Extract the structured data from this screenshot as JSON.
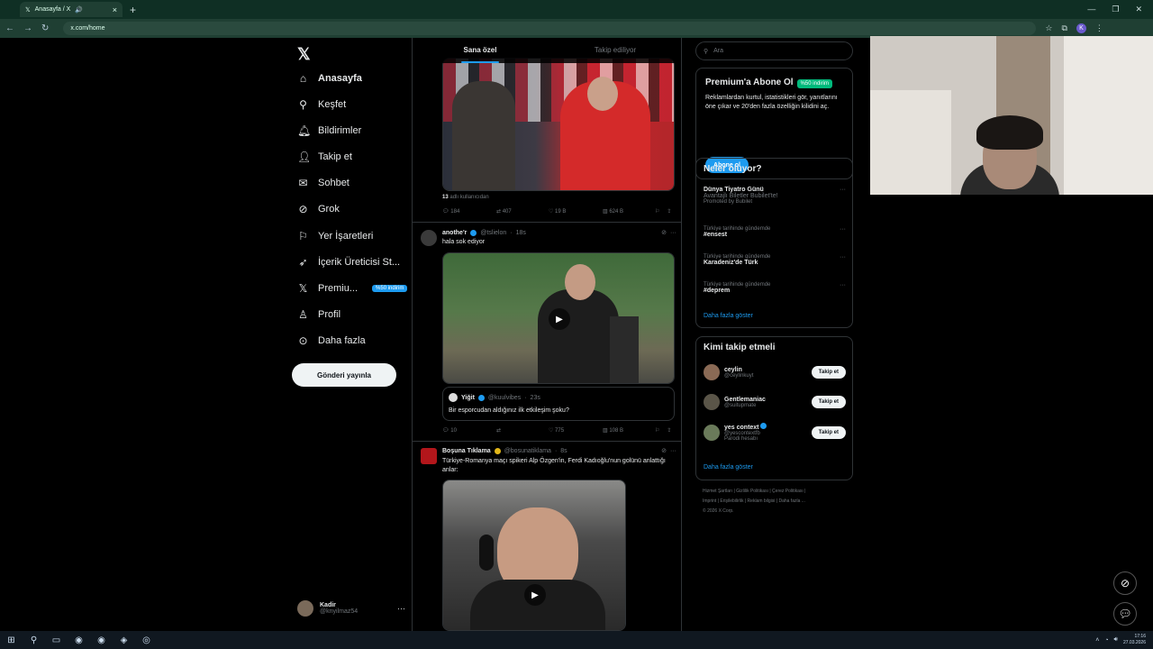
{
  "browser": {
    "tab_title": "Anasayfa / X",
    "url": "x.com/home",
    "profile_letter": "K"
  },
  "nav": {
    "items": [
      {
        "label": "Anasayfa",
        "icon": "home-icon"
      },
      {
        "label": "Keşfet",
        "icon": "search-icon"
      },
      {
        "label": "Bildirimler",
        "icon": "bell-icon"
      },
      {
        "label": "Takip et",
        "icon": "add-user-icon"
      },
      {
        "label": "Sohbet",
        "icon": "mail-icon"
      },
      {
        "label": "Grok",
        "icon": "grok-icon"
      },
      {
        "label": "Yer İşaretleri",
        "icon": "bookmark-icon"
      },
      {
        "label": "İçerik Üreticisi St...",
        "icon": "rocket-icon"
      },
      {
        "label": "Premiu...",
        "icon": "x-icon",
        "badge": "%50 indirim"
      },
      {
        "label": "Profil",
        "icon": "person-icon"
      },
      {
        "label": "Daha fazla",
        "icon": "more-circle-icon"
      }
    ],
    "post_button": "Gönderi yayınla",
    "user": {
      "name": "Kadir",
      "handle": "@knyilmaz54"
    }
  },
  "feed": {
    "tabs": [
      "Sana özel",
      "Takip ediliyor"
    ],
    "tweet1": {
      "caption_count": "13",
      "caption_text": "adlı kullanıcıdan",
      "replies": "184",
      "retweets": "407",
      "likes": "19 B",
      "views": "624 B"
    },
    "tweet2": {
      "name": "anothe'r",
      "handle": "@tslielon",
      "time": "18s",
      "text": "hala sok ediyor",
      "quote": {
        "name": "Yiğit",
        "handle": "@kuulvibes",
        "time": "23s",
        "text": "Bir esporcudan aldığınız ilk etkileşim şoku?"
      },
      "replies": "10",
      "likes": "775",
      "views": "108 B"
    },
    "tweet3": {
      "name": "Boşuna Tıklama",
      "handle": "@bosunatiklama",
      "time": "8s",
      "text": "Türkiye-Romanya maçı spikeri Alp Özgen'in, Ferdi Kadıoğlu'nun golünü anlattığı anlar:"
    }
  },
  "right": {
    "search_placeholder": "Ara",
    "premium": {
      "title": "Premium'a Abone Ol",
      "badge": "%50 indirim",
      "text": "Reklamlardan kurtul, istatistikleri gör, yanıtlarını öne çıkar ve 20'den fazla özelliğin kilidini aç.",
      "button": "Abone ol"
    },
    "trends": {
      "title": "Neler oluyor?",
      "promoted": {
        "name": "Dünya Tiyatro Günü",
        "sub": "Avantajlı Biletler Bubilet'te!",
        "tag": "Promoted by Bubilet"
      },
      "items": [
        {
          "ctx": "Türkiye tarihinde gündemde",
          "name": "#ensest"
        },
        {
          "ctx": "Türkiye tarihinde gündemde",
          "name": "Karadeniz'de Türk"
        },
        {
          "ctx": "Türkiye tarihinde gündemde",
          "name": "#deprem"
        }
      ],
      "more": "Daha fazla göster"
    },
    "who": {
      "title": "Kimi takip etmeli",
      "items": [
        {
          "name": "ceylin",
          "handle": "@ceylinkuyt",
          "button": "Takip et"
        },
        {
          "name": "Gentlemaniac",
          "handle": "@suitupmate",
          "button": "Takip et"
        },
        {
          "name": "yes context",
          "handle": "@yescontextfb",
          "note": "Parodi hesabı",
          "button": "Takip et"
        }
      ],
      "more": "Daha fazla göster"
    },
    "footer": {
      "line1": "Hizmet Şartları | Gizlilik Politikası | Çerez Politikası |",
      "line2": "Imprint | Erişilebilirlik | Reklam bilgisi | Daha fazla ...",
      "line3": "© 2026 X Corp."
    }
  },
  "taskbar": {
    "time": "17:16",
    "date": "27.03.2026"
  }
}
